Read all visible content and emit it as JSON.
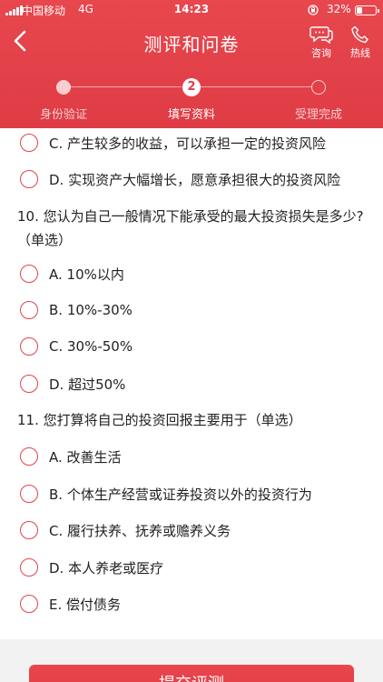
{
  "status_bar": {
    "carrier": "中国移动",
    "network": "4G",
    "time": "14:23",
    "battery": "32%",
    "battery_level": 0.32
  },
  "header": {
    "title": "测评和问卷",
    "back_icon": "chevron-left-icon",
    "actions": [
      {
        "label": "咨询",
        "icon": "chat-bubble-icon"
      },
      {
        "label": "热线",
        "icon": "phone-icon"
      }
    ]
  },
  "steps": [
    {
      "number": "",
      "label": "身份验证",
      "state": "done"
    },
    {
      "number": "2",
      "label": "填写资料",
      "state": "active"
    },
    {
      "number": "",
      "label": "受理完成",
      "state": "todo"
    }
  ],
  "q9": {
    "options": [
      {
        "text": "C. 产生较多的收益，可以承担一定的投资风险"
      },
      {
        "text": "D. 实现资产大幅增长，愿意承担很大的投资风险"
      }
    ]
  },
  "q10": {
    "title": "10. 您认为自己一般情况下能承受的最大投资损失是多少?（单选）",
    "options": [
      {
        "text": "A. 10%以内"
      },
      {
        "text": "B. 10%-30%"
      },
      {
        "text": "C. 30%-50%"
      },
      {
        "text": "D. 超过50%"
      }
    ]
  },
  "q11": {
    "title": "11. 您打算将自己的投资回报主要用于（单选）",
    "options": [
      {
        "text": "A. 改善生活"
      },
      {
        "text": "B. 个体生产经营或证券投资以外的投资行为"
      },
      {
        "text": "C. 履行扶养、抚养或赡养义务"
      },
      {
        "text": "D. 本人养老或医疗"
      },
      {
        "text": "E. 偿付债务"
      }
    ]
  },
  "submit_label": "提交评测",
  "colors": {
    "brand": "#e0444c",
    "bottom_bar": "#f2f2f2"
  }
}
